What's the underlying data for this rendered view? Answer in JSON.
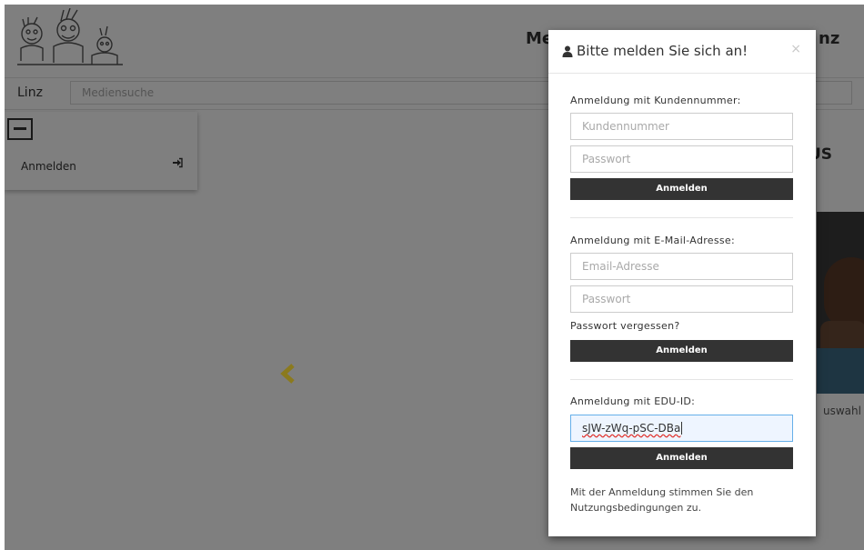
{
  "header": {
    "title": "Me",
    "title_right": "nz"
  },
  "searchbar": {
    "library": "Linz",
    "placeholder": "Mediensuche"
  },
  "sidemenu": {
    "login_label": "Anmelden"
  },
  "content": {
    "section_title_right": "US",
    "selection_label": "uswahl"
  },
  "modal": {
    "title": "Bitte melden Sie sich an!",
    "close": "×",
    "customer_section": {
      "label": "Anmeldung mit Kundennummer:",
      "customer_placeholder": "Kundennummer",
      "password_placeholder": "Passwort",
      "button": "Anmelden"
    },
    "email_section": {
      "label": "Anmeldung mit E-Mail-Adresse:",
      "email_placeholder": "Email-Adresse",
      "password_placeholder": "Passwort",
      "forgot": "Passwort vergessen?",
      "button": "Anmelden"
    },
    "edu_section": {
      "label": "Anmeldung mit EDU-ID:",
      "value": "sJW-zWq-pSC-DBa",
      "button": "Anmelden"
    },
    "terms": "Mit der Anmeldung stimmen Sie den Nutzungsbedingungen zu."
  },
  "icons": {
    "user": "user-icon",
    "close": "close-icon",
    "sign_in": "sign-in-icon",
    "collapse": "minus-square-icon",
    "prev": "chevron-left-icon"
  },
  "colors": {
    "button_bg": "#333333",
    "overlay": "rgba(0,0,0,0.5)",
    "focus_border": "#66afe9",
    "arrow": "#8b7a1e"
  }
}
